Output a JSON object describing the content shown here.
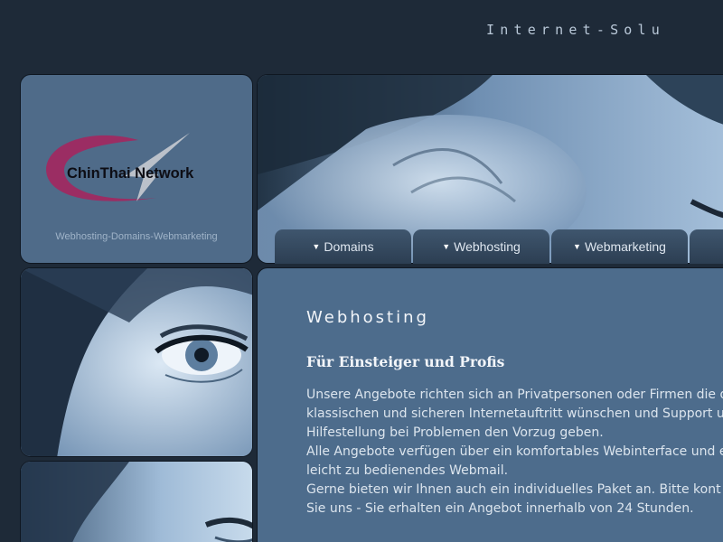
{
  "header": {
    "tagline": "Internet-Solu"
  },
  "logo": {
    "name": "ChinThai Network",
    "subtitle": "Webhosting-Domains-Webmarketing",
    "colors": {
      "swoosh": "#9b2d63",
      "arrow": "#c7cbd1",
      "text": "#0d0d14"
    }
  },
  "nav": {
    "items": [
      {
        "label": "Domains"
      },
      {
        "label": "Webhosting"
      },
      {
        "label": "Webmarketing"
      }
    ]
  },
  "content": {
    "heading": "Webhosting",
    "subheading": "Für Einsteiger und Profis",
    "lines": [
      "Unsere Angebote richten sich an Privatpersonen oder Firmen die d",
      "klassischen und sicheren Internetauftritt wünschen und Support u",
      "Hilfestellung bei Problemen den Vorzug geben.",
      "Alle Angebote verfügen über ein komfortables Webinterface und e",
      "leicht zu bedienendes Webmail.",
      "Gerne bieten wir Ihnen auch ein individuelles Paket an. Bitte kont",
      "Sie uns - Sie erhalten ein Angebot innerhalb von 24 Stunden."
    ]
  },
  "colors": {
    "background": "#1e2a38",
    "panel": "#4f6b89",
    "tab": "#34495f"
  }
}
